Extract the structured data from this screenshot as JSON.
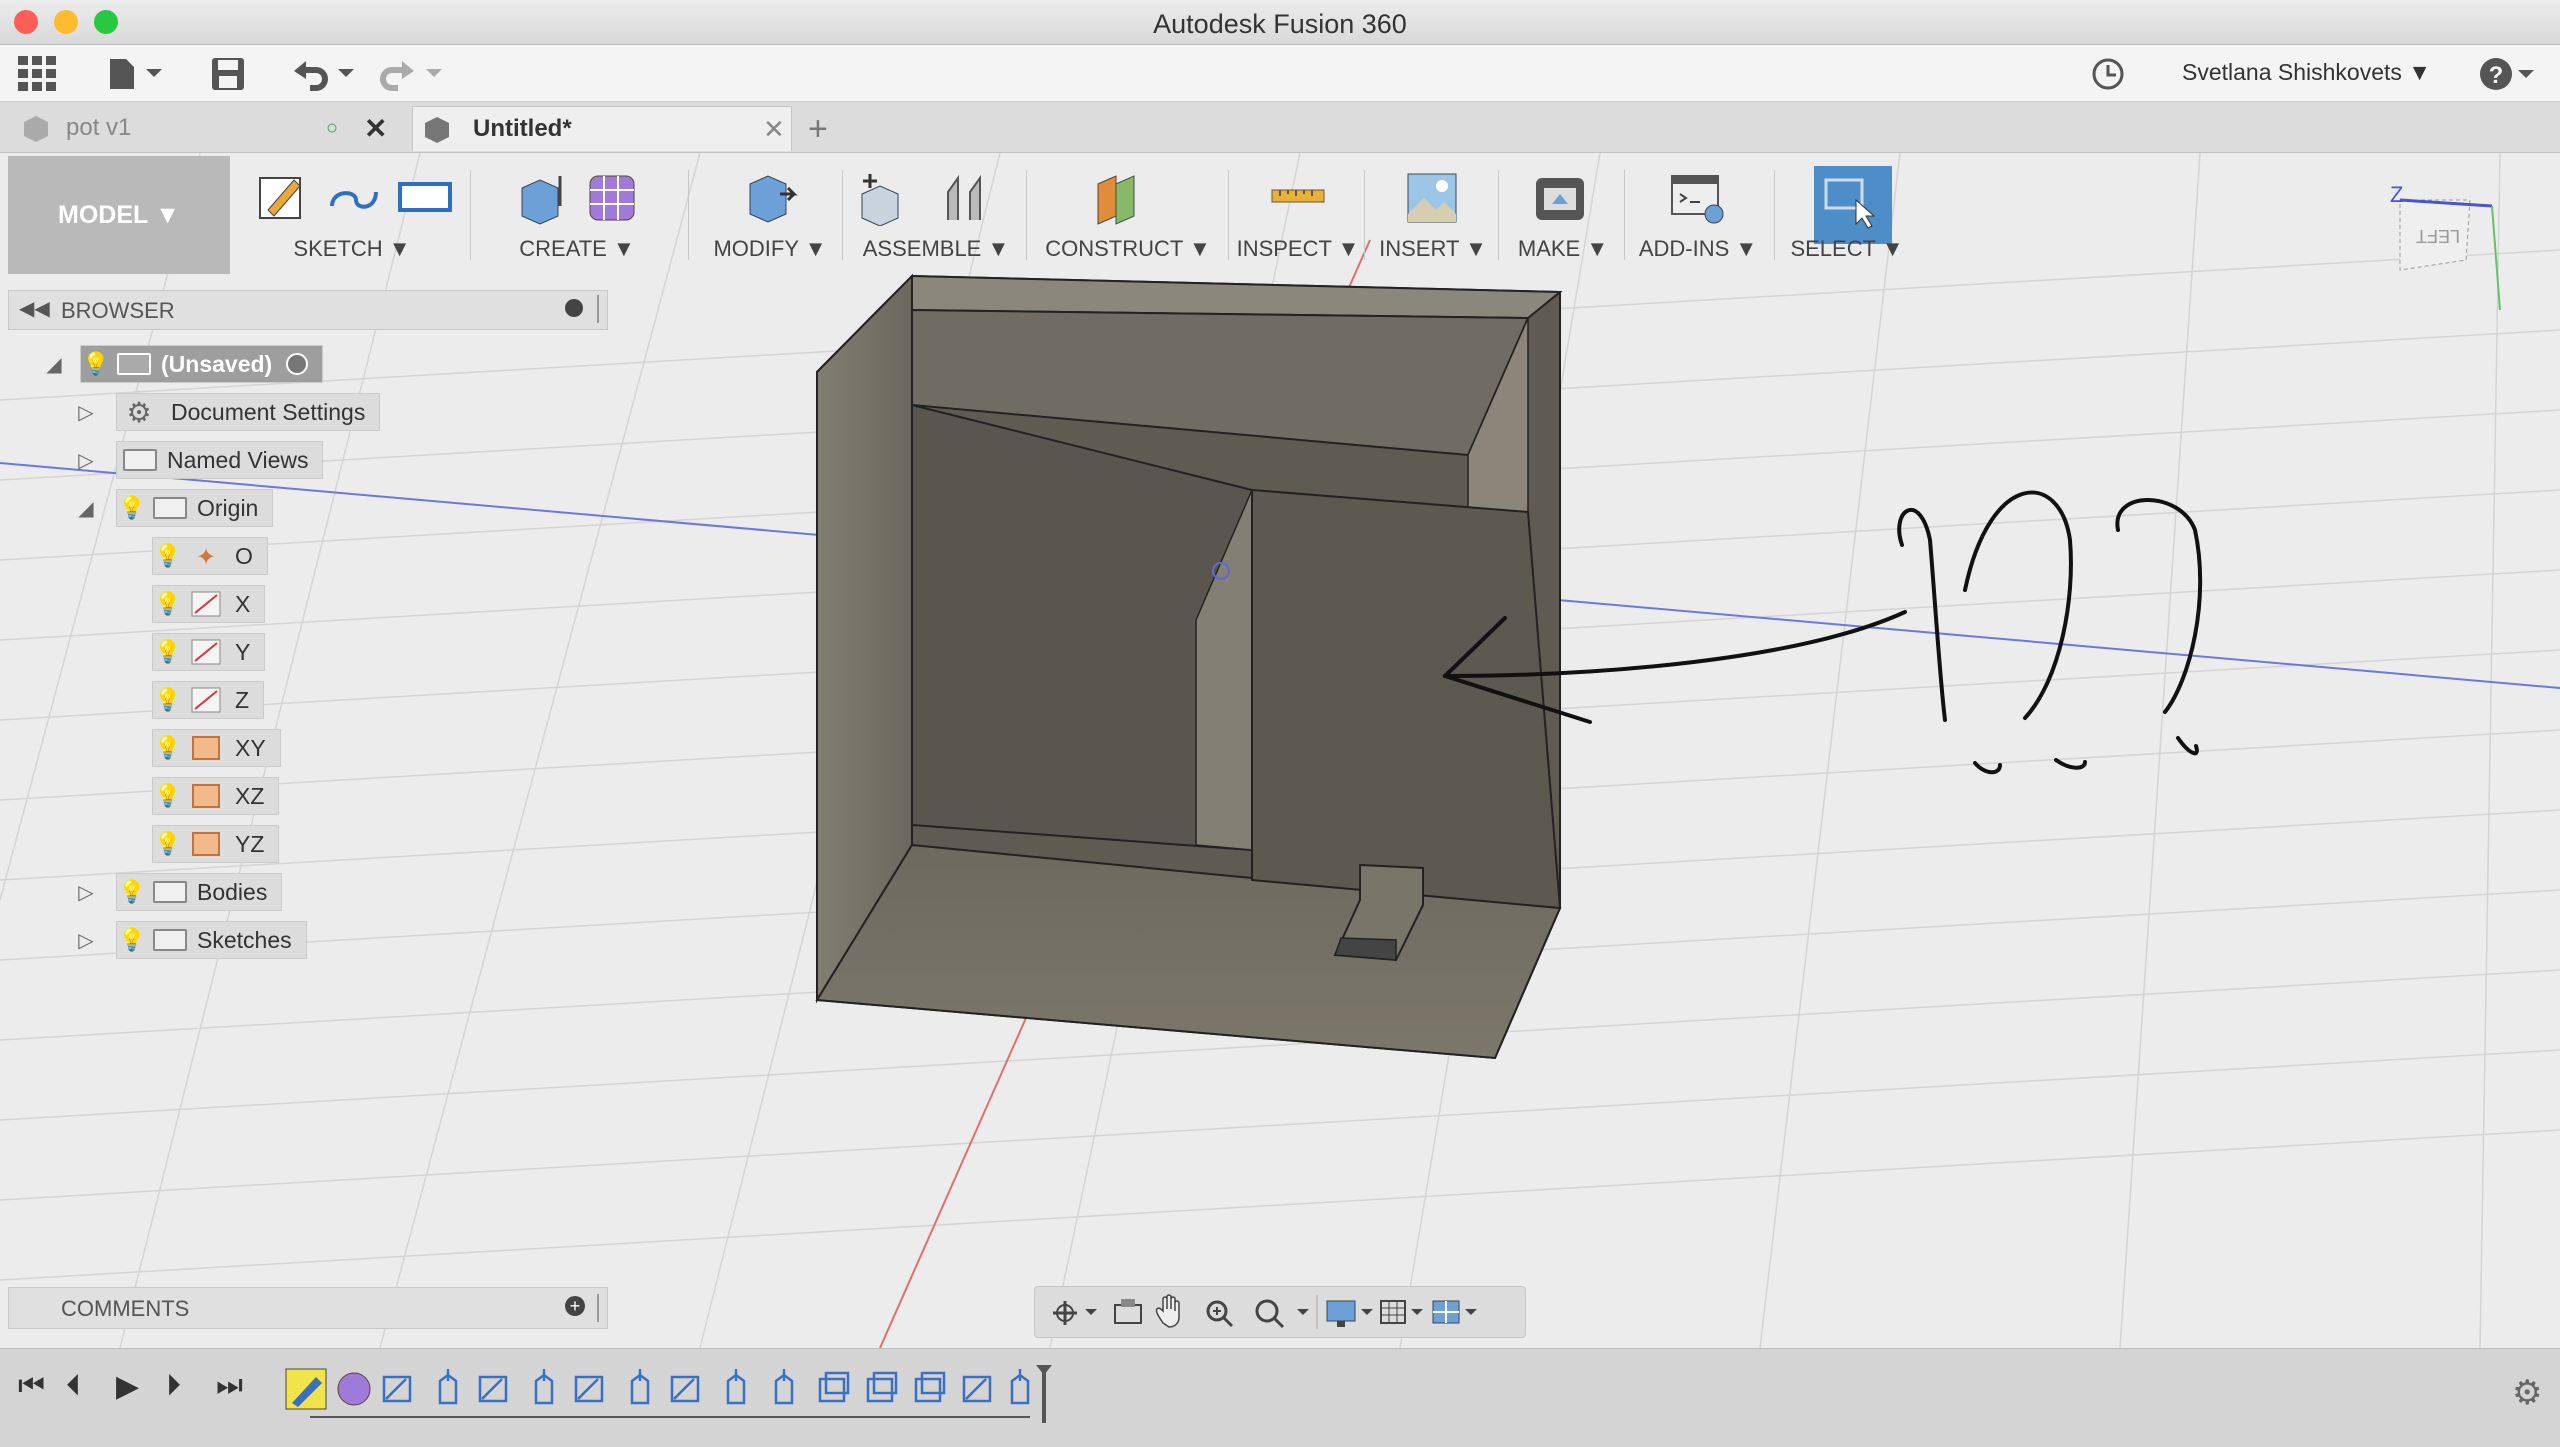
{
  "window": {
    "title": "Autodesk Fusion 360"
  },
  "qat": {
    "user": "Svetlana Shishkovets"
  },
  "tabs": [
    {
      "label": "pot v1",
      "active": false
    },
    {
      "label": "Untitled*",
      "active": true
    }
  ],
  "ribbon": {
    "workspace": "MODEL",
    "groups": [
      "SKETCH",
      "CREATE",
      "MODIFY",
      "ASSEMBLE",
      "CONSTRUCT",
      "INSPECT",
      "INSERT",
      "MAKE",
      "ADD-INS",
      "SELECT"
    ]
  },
  "browser": {
    "title": "BROWSER",
    "root": "(Unsaved)",
    "items": [
      "Document Settings",
      "Named Views",
      "Origin",
      "O",
      "X",
      "Y",
      "Z",
      "XY",
      "XZ",
      "YZ",
      "Bodies",
      "Sketches"
    ]
  },
  "comments": {
    "title": "COMMENTS"
  },
  "viewcube": {
    "face": "LEFT",
    "axis": "Z"
  },
  "colors": {
    "accent": "#4f8dc9",
    "model": "#6f6b63",
    "grid": "#d6d6d6"
  }
}
